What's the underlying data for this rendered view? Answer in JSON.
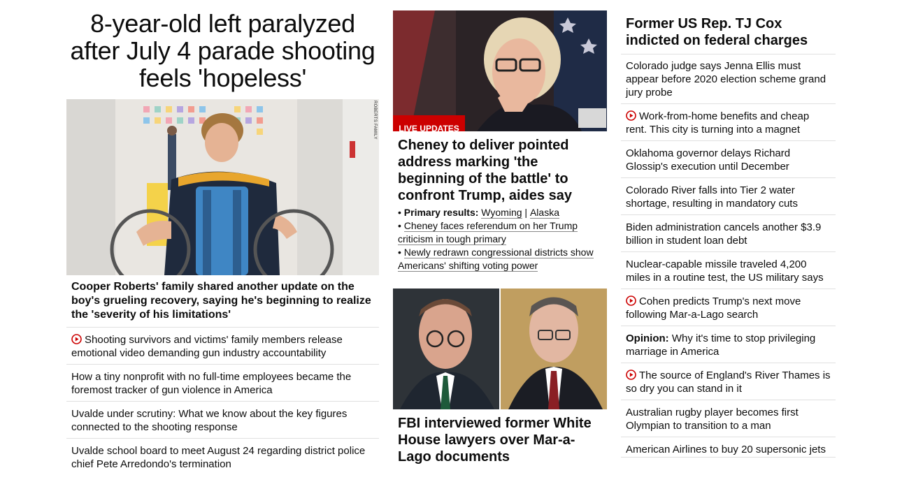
{
  "left": {
    "headline": "8-year-old left paralyzed after July 4 parade shooting feels 'hopeless'",
    "image_credit": "ROBERTS FAMILY",
    "caption": "Cooper Roberts' family shared another update on the boy's grueling recovery, saying he's beginning to realize the 'severity of his limitations'",
    "items": [
      {
        "text": "Shooting survivors and victims' family members release emotional video demanding gun industry accountability",
        "video": true
      },
      {
        "text": "How a tiny nonprofit with no full-time employees became the foremost tracker of gun violence in America",
        "video": false
      },
      {
        "text": "Uvalde under scrutiny: What we know about the key figures connected to the shooting response",
        "video": false
      },
      {
        "text": "Uvalde school board to meet August 24 regarding district police chief Pete Arredondo's termination",
        "video": false
      }
    ]
  },
  "middle": {
    "badge": "LIVE UPDATES",
    "headline1": "Cheney to deliver pointed address marking 'the beginning of the battle' to confront Trump, aides say",
    "bullets": {
      "b1_label": "Primary results:",
      "b1_link1": "Wyoming",
      "b1_sep": "|",
      "b1_link2": "Alaska",
      "b2": "Cheney faces referendum on her Trump criticism in tough primary",
      "b3": "Newly redrawn congressional districts show Americans' shifting voting power"
    },
    "headline2": "FBI interviewed former White House lawyers over Mar-a-Lago documents"
  },
  "right": {
    "headline": "Former US Rep. TJ Cox indicted on federal charges",
    "items": [
      {
        "text": "Colorado judge says Jenna Ellis must appear before 2020 election scheme grand jury probe",
        "video": false
      },
      {
        "text": "Work-from-home benefits and cheap rent. This city is turning into a magnet",
        "video": true
      },
      {
        "text": "Oklahoma governor delays Richard Glossip's execution until December",
        "video": false
      },
      {
        "text": "Colorado River falls into Tier 2 water shortage, resulting in mandatory cuts",
        "video": false
      },
      {
        "text": "Biden administration cancels another $3.9 billion in student loan debt",
        "video": false
      },
      {
        "text": "Nuclear-capable missile traveled 4,200 miles in a routine test, the US military says",
        "video": false
      },
      {
        "text": "Cohen predicts Trump's next move following Mar-a-Lago search",
        "video": true
      },
      {
        "label": "Opinion:",
        "text": "Why it's time to stop privileging marriage in America",
        "video": false
      },
      {
        "text": "The source of England's River Thames is so dry you can stand in it",
        "video": true
      },
      {
        "text": "Australian rugby player becomes first Olympian to transition to a man",
        "video": false
      },
      {
        "text": "American Airlines to buy 20 supersonic jets",
        "video": false
      }
    ]
  },
  "colors": {
    "accent_red": "#cc0000",
    "divider": "#e0e0e0",
    "text": "#0c0c0c"
  },
  "icons": {
    "video": "play-circle-icon"
  }
}
